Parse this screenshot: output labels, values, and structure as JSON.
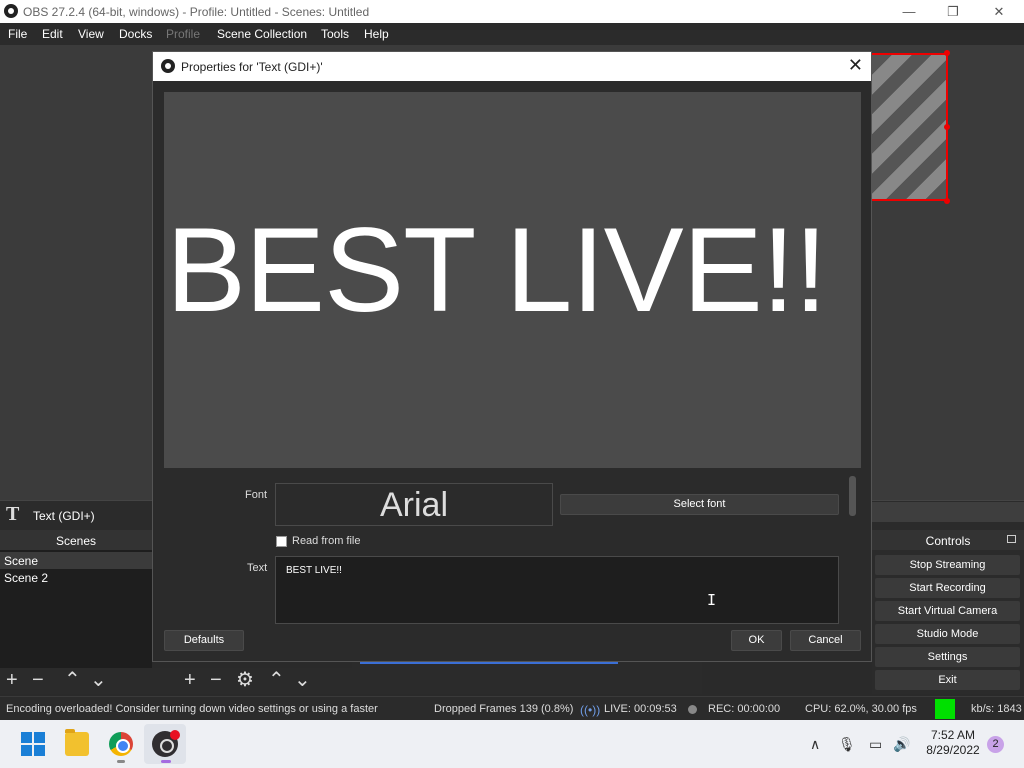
{
  "window": {
    "title": "OBS 27.2.4 (64-bit, windows) - Profile: Untitled - Scenes: Untitled",
    "minimize": "—",
    "maximize": "❐",
    "close": "✕"
  },
  "menu": [
    "File",
    "Edit",
    "View",
    "Docks",
    "Profile",
    "Scene Collection",
    "Tools",
    "Help"
  ],
  "source_bar": {
    "icon": "T",
    "label": "Text (GDI+)"
  },
  "scenes": {
    "title": "Scenes",
    "items": [
      "Scene",
      "Scene 2"
    ],
    "selected": "Scene"
  },
  "toolbar_icons": [
    "+",
    "−",
    "⌃",
    "⌄",
    "+",
    "−",
    "⚙",
    "⌃",
    "⌄"
  ],
  "controls": {
    "title": "Controls",
    "buttons": [
      "Stop Streaming",
      "Start Recording",
      "Start Virtual Camera",
      "Studio Mode",
      "Settings",
      "Exit"
    ]
  },
  "status": {
    "message": "Encoding overloaded! Consider turning down video settings or using a faster",
    "dropped": "Dropped Frames 139 (0.8%)",
    "live": "LIVE: 00:09:53",
    "rec": "REC: 00:00:00",
    "cpu": "CPU: 62.0%, 30.00 fps",
    "kbps": "kb/s: 1843"
  },
  "dialog": {
    "title": "Properties for 'Text (GDI+)'",
    "close": "✕",
    "preview_text": "BEST LIVE!!",
    "font_label": "Font",
    "font_value": "Arial",
    "select_font": "Select font",
    "read_from_file": "Read from file",
    "text_label": "Text",
    "text_value": "BEST LIVE!!",
    "defaults": "Defaults",
    "ok": "OK",
    "cancel": "Cancel"
  },
  "taskbar": {
    "tray_chevron": "∧",
    "mic": "🎙",
    "net": "▭",
    "volume": "🔊",
    "time": "7:52 AM",
    "date": "8/29/2022",
    "notifications": "2"
  },
  "colors": {
    "accent_red": "#e00000",
    "live_blue": "#6f9ce6",
    "green_indicator": "#00e000"
  }
}
